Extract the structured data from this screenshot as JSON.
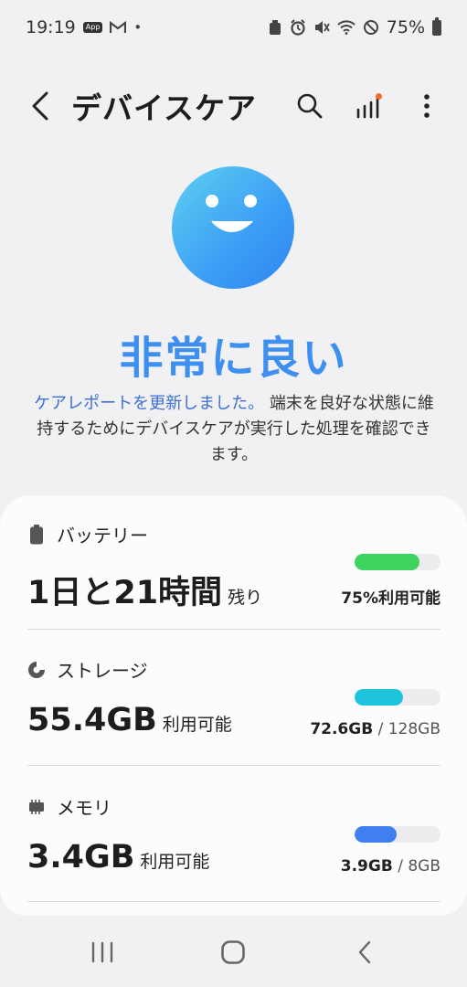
{
  "status_bar": {
    "time": "19:19",
    "app_badge": "App",
    "battery_percent": "75%"
  },
  "app_bar": {
    "title": "デバイスケア",
    "back_icon": "back-chevron-icon",
    "search_icon": "search-icon",
    "stats_icon": "signal-stats-icon",
    "more_icon": "more-vertical-icon"
  },
  "hero": {
    "status_label": "非常に良い",
    "status_color": "#3d8ff0",
    "description_link": "ケアレポートを更新しました。",
    "description_text": "端末を良好な状態に維持するためにデバイスケアが実行した処理を確認できます。"
  },
  "battery": {
    "label": "バッテリー",
    "value": "1日と21時間",
    "suffix": "残り",
    "usage_bold": "75%利用可能",
    "fill_fraction": 0.75,
    "color": "#3ed25e"
  },
  "storage": {
    "label": "ストレージ",
    "value": "55.4GB",
    "suffix": "利用可能",
    "used": "72.6GB",
    "total": "/ 128GB",
    "fill_fraction": 0.567,
    "color": "#1ec4dc"
  },
  "memory": {
    "label": "メモリ",
    "value": "3.4GB",
    "suffix": "利用可能",
    "used": "3.9GB",
    "total": "/ 8GB",
    "fill_fraction": 0.4875,
    "color": "#3f7ff0"
  },
  "colors": {
    "accent_dot": "#f26d21"
  },
  "nav_bar": {
    "recents_icon": "recents-icon",
    "home_icon": "home-icon",
    "back_icon": "nav-back-icon"
  }
}
